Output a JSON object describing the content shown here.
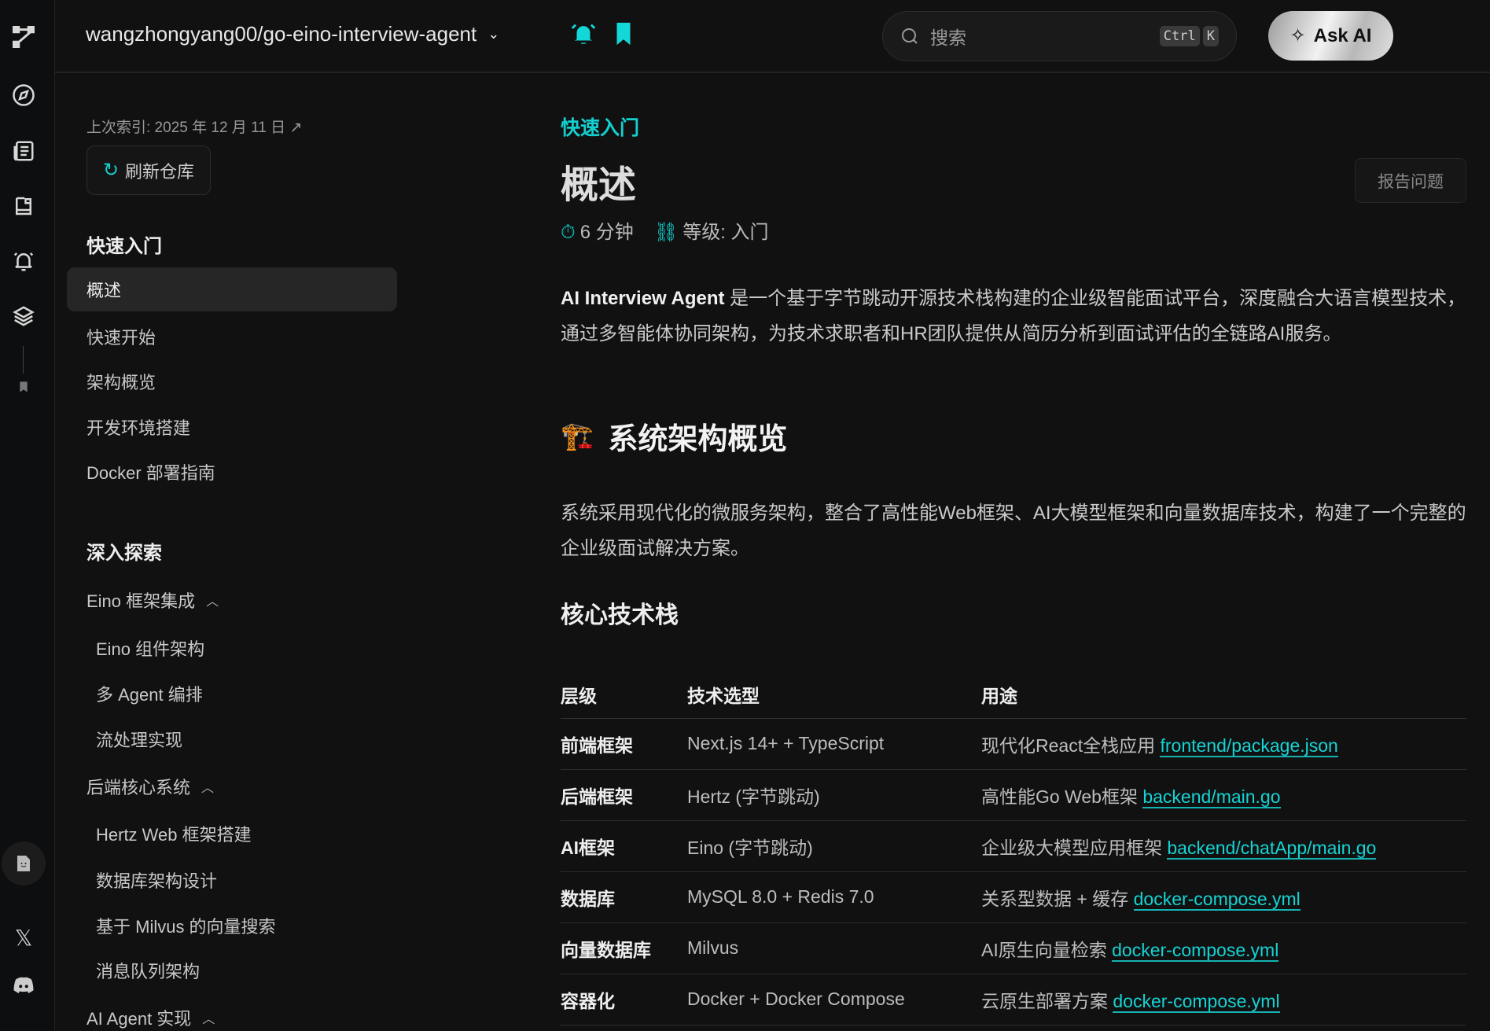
{
  "header": {
    "repo": "wangzhongyang00/go-eino-interview-agent",
    "search_placeholder": "搜索",
    "kbd_ctrl": "Ctrl",
    "kbd_k": "K",
    "ask_ai": "Ask AI"
  },
  "nav": {
    "last_index": "上次索引: 2025 年 12 月 11 日 ↗",
    "refresh": "刷新仓库",
    "section1": "快速入门",
    "items1": [
      "概述",
      "快速开始",
      "架构概览",
      "开发环境搭建",
      "Docker 部署指南"
    ],
    "section2": "深入探索",
    "group1": "Eino 框架集成",
    "group1_items": [
      "Eino 组件架构",
      "多 Agent 编排",
      "流处理实现"
    ],
    "group2": "后端核心系统",
    "group2_items": [
      "Hertz Web 框架搭建",
      "数据库架构设计",
      "基于 Milvus 的向量搜索",
      "消息队列架构"
    ],
    "group3": "AI Agent 实现"
  },
  "main": {
    "crumb": "快速入门",
    "title": "概述",
    "read_time": "6 分钟",
    "level": "等级: 入门",
    "report": "报告问题",
    "intro_bold": "AI Interview Agent",
    "intro": " 是一个基于字节跳动开源技术栈构建的企业级智能面试平台，深度融合大语言模型技术，通过多智能体协同架构，为技术求职者和HR团队提供从简历分析到面试评估的全链路AI服务。",
    "h2_emoji": "🏗️",
    "h2": "系统架构概览",
    "para2": "系统采用现代化的微服务架构，整合了高性能Web框架、AI大模型框架和向量数据库技术，构建了一个完整的企业级面试解决方案。",
    "h3": "核心技术栈",
    "table": {
      "headers": [
        "层级",
        "技术选型",
        "用途"
      ],
      "rows": [
        [
          "前端框架",
          "Next.js 14+ + TypeScript",
          "现代化React全栈应用 ",
          "frontend/package.json"
        ],
        [
          "后端框架",
          "Hertz (字节跳动)",
          "高性能Go Web框架 ",
          "backend/main.go"
        ],
        [
          "AI框架",
          "Eino (字节跳动)",
          "企业级大模型应用框架 ",
          "backend/chatApp/main.go"
        ],
        [
          "数据库",
          "MySQL 8.0 + Redis 7.0",
          "关系型数据 + 缓存 ",
          "docker-compose.yml"
        ],
        [
          "向量数据库",
          "Milvus",
          "AI原生向量检索 ",
          "docker-compose.yml"
        ],
        [
          "容器化",
          "Docker + Docker Compose",
          "云原生部署方案 ",
          "docker-compose.yml"
        ]
      ]
    }
  }
}
